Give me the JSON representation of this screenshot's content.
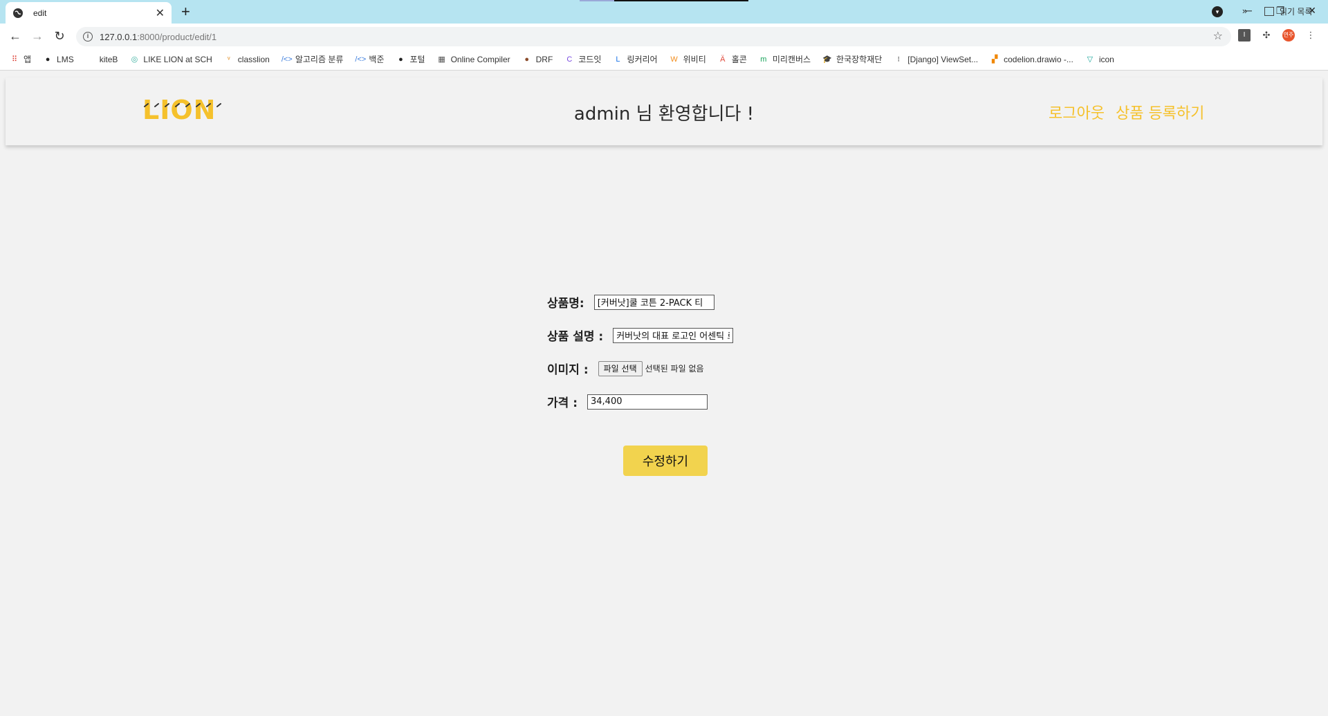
{
  "browser": {
    "tab_title": "edit",
    "new_tab": "+",
    "url_host": "127.0.0.1",
    "url_rest": ":8000/product/edit/1",
    "profile_initials": "연주",
    "bookmarks": [
      {
        "label": "앱",
        "icon": "apps-grid-icon",
        "glyph": "⠿",
        "color": "#d93025"
      },
      {
        "label": "LMS",
        "icon": "globe-icon",
        "glyph": "●",
        "color": "#222222"
      },
      {
        "label": "kiteB",
        "icon": "blank-icon",
        "glyph": " ",
        "color": "#222222"
      },
      {
        "label": "LIKE LION at SCH",
        "icon": "lion-circle-icon",
        "glyph": "◎",
        "color": "#3bb0a0"
      },
      {
        "label": "classlion",
        "icon": "classlion-icon",
        "glyph": "ᵛ",
        "color": "#e08a1e"
      },
      {
        "label": "알고리즘 분류",
        "icon": "code-icon",
        "glyph": "/<>",
        "color": "#3b7ddd"
      },
      {
        "label": "백준",
        "icon": "code-icon",
        "glyph": "/<>",
        "color": "#3b7ddd"
      },
      {
        "label": "포털",
        "icon": "globe-icon",
        "glyph": "●",
        "color": "#222222"
      },
      {
        "label": "Online Compiler",
        "icon": "compiler-icon",
        "glyph": "▦",
        "color": "#555555"
      },
      {
        "label": "DRF",
        "icon": "drf-icon",
        "glyph": "●",
        "color": "#8a4b2b"
      },
      {
        "label": "코드잇",
        "icon": "codeit-icon",
        "glyph": "C",
        "color": "#7a4be0"
      },
      {
        "label": "링커리어",
        "icon": "linkareer-icon",
        "glyph": "L",
        "color": "#1a73e8"
      },
      {
        "label": "위비티",
        "icon": "wevity-icon",
        "glyph": "W",
        "color": "#f28c1b"
      },
      {
        "label": "홀콘",
        "icon": "holcon-icon",
        "glyph": "Ä",
        "color": "#e0483a"
      },
      {
        "label": "미리캔버스",
        "icon": "miricanvas-icon",
        "glyph": "m",
        "color": "#16a35a"
      },
      {
        "label": "한국장학재단",
        "icon": "scholarship-icon",
        "glyph": "🎓",
        "color": "#1d4fa3"
      },
      {
        "label": "[Django] ViewSet...",
        "icon": "tistory-icon",
        "glyph": "⁝",
        "color": "#222222"
      },
      {
        "label": "codelion.drawio -...",
        "icon": "drawio-icon",
        "glyph": "▞",
        "color": "#f08705"
      },
      {
        "label": "icon",
        "icon": "vuetify-icon",
        "glyph": "▽",
        "color": "#1aa59a"
      }
    ],
    "more_bookmarks": "»",
    "reading_list": "읽기 목록"
  },
  "header": {
    "logo_text": "LION",
    "welcome": "admin 님 환영합니다 !",
    "logout": "로그아웃",
    "register": "상품 등록하기"
  },
  "form": {
    "name_label": "상품명:",
    "name_value": "[커버낫]쿨 코튼 2-PACK 티",
    "desc_label": "상품 설명 :",
    "desc_value": "커버낫의 대표 로고인 어센틱 로",
    "image_label": "이미지 :",
    "file_button": "파일 선택",
    "file_status": "선택된 파일 없음",
    "price_label": "가격 :",
    "price_value": "34,400",
    "submit": "수정하기"
  },
  "colors": {
    "accent": "#f5c12c",
    "button": "#f2d34e",
    "tabbar": "#b6e4f1"
  }
}
